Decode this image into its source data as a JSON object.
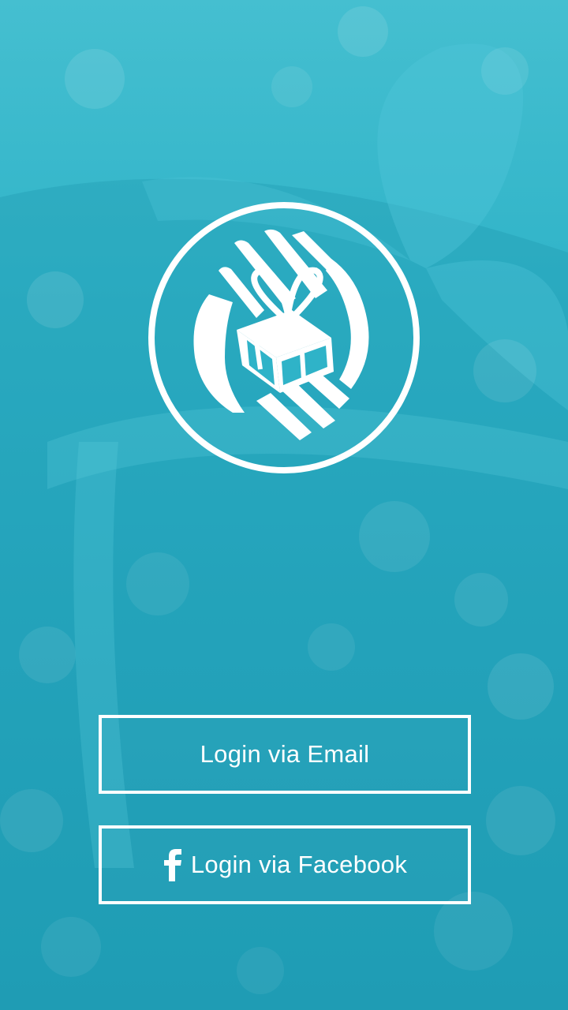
{
  "app": {
    "logo_icon": "hands-holding-gift-icon"
  },
  "buttons": {
    "email_login_label": "Login via Email",
    "facebook_login_label": "Login via Facebook",
    "facebook_icon": "facebook-icon"
  },
  "colors": {
    "background_top": "#45bfd0",
    "background_bottom": "#1f9fb7",
    "foreground": "#ffffff"
  }
}
